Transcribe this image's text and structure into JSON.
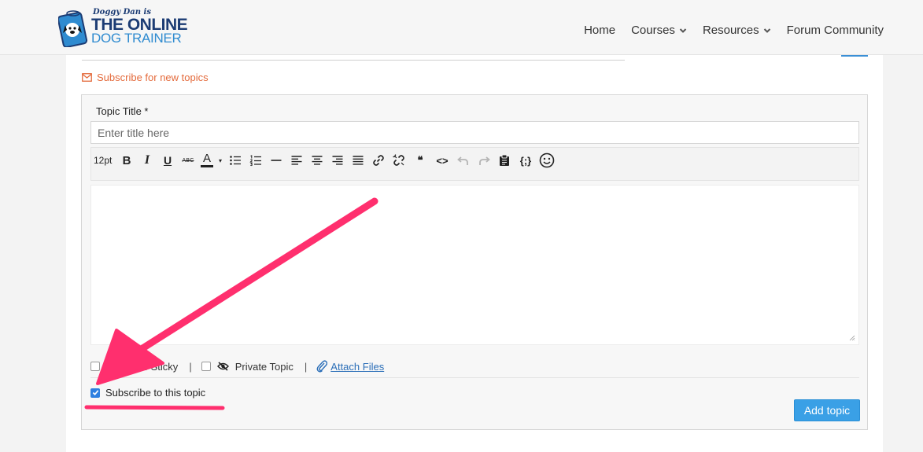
{
  "header": {
    "logo": {
      "top_line": "Doggy Dan is",
      "line1": "THE ONLINE",
      "line2": "DOG TRAINER"
    },
    "nav": [
      {
        "label": "Home",
        "has_dropdown": false
      },
      {
        "label": "Courses",
        "has_dropdown": true
      },
      {
        "label": "Resources",
        "has_dropdown": true
      },
      {
        "label": "Forum Community",
        "has_dropdown": false
      }
    ]
  },
  "subscribe_new": {
    "label": "Subscribe for new topics",
    "icon": "envelope-icon",
    "color": "#e46a3b"
  },
  "form": {
    "title_label": "Topic Title *",
    "title_placeholder": "Enter title here",
    "title_value": "",
    "toolbar": {
      "font_size": "12pt",
      "bold": "B",
      "italic": "I",
      "underline": "U",
      "strike": "ABC",
      "text_color": "A",
      "caret": "▾",
      "blockquote": "❝",
      "source": "<>",
      "shortcode": "{;}",
      "emoji": "☺"
    },
    "options": {
      "sticky_label": "Topic Sticky",
      "sticky_checked": false,
      "separator": "|",
      "private_label": "Private Topic",
      "private_checked": false,
      "attach_label": "Attach Files"
    },
    "subscribe_topic": {
      "label": "Subscribe to this topic",
      "checked": true
    },
    "submit_label": "Add topic"
  },
  "colors": {
    "accent": "#3aa0e6",
    "annotation_arrow": "#ff2f6e",
    "link": "#2c6fb8"
  }
}
